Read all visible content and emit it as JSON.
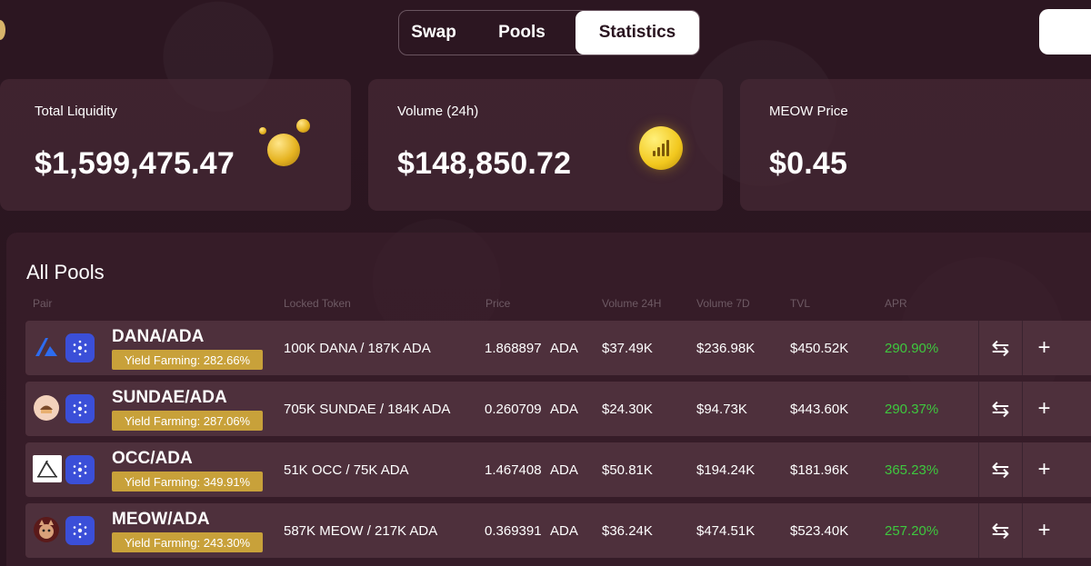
{
  "tabs": [
    {
      "label": "Swap"
    },
    {
      "label": "Pools"
    },
    {
      "label": "Statistics"
    }
  ],
  "stats": {
    "total_liquidity": {
      "label": "Total Liquidity",
      "value": "$1,599,475.47"
    },
    "volume_24h": {
      "label": "Volume (24h)",
      "value": "$148,850.72"
    },
    "meow_price": {
      "label": "MEOW Price",
      "value": "$0.45"
    }
  },
  "pools": {
    "title": "All Pools",
    "columns": [
      "Pair",
      "Locked Token",
      "Price",
      "Volume 24H",
      "Volume 7D",
      "TVL",
      "APR"
    ],
    "rows": [
      {
        "pair": "DANA/ADA",
        "yield": "Yield Farming: 282.66%",
        "locked": "100K DANA / 187K ADA",
        "price": "1.868897",
        "price_unit": "ADA",
        "vol24": "$37.49K",
        "vol7": "$236.98K",
        "tvl": "$450.52K",
        "apr": "290.90%",
        "icon": "dana-icon"
      },
      {
        "pair": "SUNDAE/ADA",
        "yield": "Yield Farming: 287.06%",
        "locked": "705K SUNDAE / 184K ADA",
        "price": "0.260709",
        "price_unit": "ADA",
        "vol24": "$24.30K",
        "vol7": "$94.73K",
        "tvl": "$443.60K",
        "apr": "290.37%",
        "icon": "sundae-icon"
      },
      {
        "pair": "OCC/ADA",
        "yield": "Yield Farming: 349.91%",
        "locked": "51K OCC / 75K ADA",
        "price": "1.467408",
        "price_unit": "ADA",
        "vol24": "$50.81K",
        "vol7": "$194.24K",
        "tvl": "$181.96K",
        "apr": "365.23%",
        "icon": "occ-icon"
      },
      {
        "pair": "MEOW/ADA",
        "yield": "Yield Farming: 243.30%",
        "locked": "587K MEOW / 217K ADA",
        "price": "0.369391",
        "price_unit": "ADA",
        "vol24": "$36.24K",
        "vol7": "$474.51K",
        "tvl": "$523.40K",
        "apr": "257.20%",
        "icon": "meow-icon"
      }
    ],
    "actions": {
      "swap_icon": "⇆",
      "add_icon": "+"
    }
  },
  "colors": {
    "accent_yield": "#c8a13a",
    "apr_green": "#3ec83e",
    "background": "#2a1520"
  }
}
